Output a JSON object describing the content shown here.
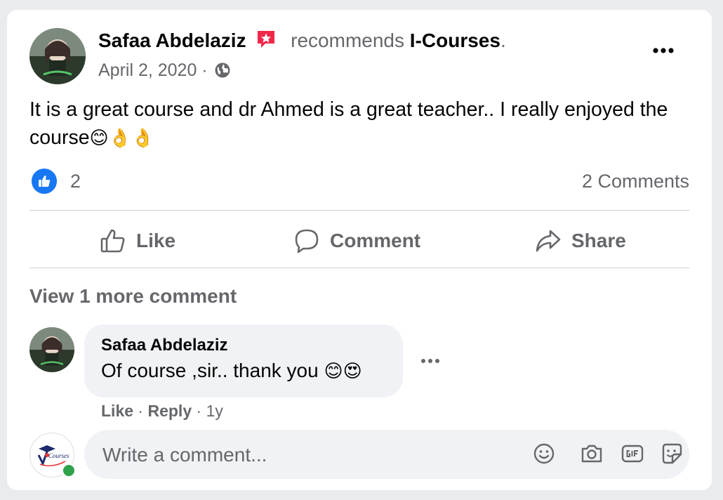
{
  "post": {
    "author": "Safaa Abdelaziz",
    "recommends_text": "recommends",
    "page_name": "I-Courses",
    "page_name_suffix": ".",
    "date": "April 2, 2020",
    "date_separator": "·",
    "visibility_icon": "globe-icon",
    "text": "It is a great course and dr Ahmed is a great teacher.. I really enjoyed the course",
    "text_emojis": "😊👌👌",
    "reaction_icon": "like-icon",
    "reaction_count": "2",
    "comments_count": "2 Comments"
  },
  "actions": {
    "like": "Like",
    "comment": "Comment",
    "share": "Share"
  },
  "comments": {
    "view_more": "View 1 more comment",
    "items": [
      {
        "author": "Safaa Abdelaziz",
        "text": "Of course ,sir.. thank you ",
        "emojis": "😊😍",
        "like": "Like",
        "separator": "·",
        "reply": "Reply",
        "age": "1y"
      }
    ]
  },
  "composer": {
    "placeholder": "Write a comment...",
    "tools": [
      "smiley-icon",
      "camera-icon",
      "gif-icon",
      "sticker-icon"
    ],
    "logo_text": "Courses"
  },
  "colors": {
    "accent": "#1877f2",
    "secondary_text": "#65676b",
    "online": "#31a24c",
    "badge": "#f02849"
  }
}
